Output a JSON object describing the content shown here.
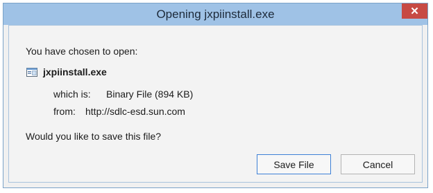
{
  "window": {
    "title": "Opening jxpiinstall.exe"
  },
  "dialog": {
    "intro": "You have chosen to open:",
    "file_name": "jxpiinstall.exe",
    "type_label": "which is:",
    "type_value": "Binary File (894 KB)",
    "from_label": "from:",
    "from_value": "http://sdlc-esd.sun.com",
    "question": "Would you like to save this file?"
  },
  "buttons": {
    "save": "Save File",
    "cancel": "Cancel"
  },
  "icons": {
    "close": "close-icon",
    "file": "file-icon"
  }
}
